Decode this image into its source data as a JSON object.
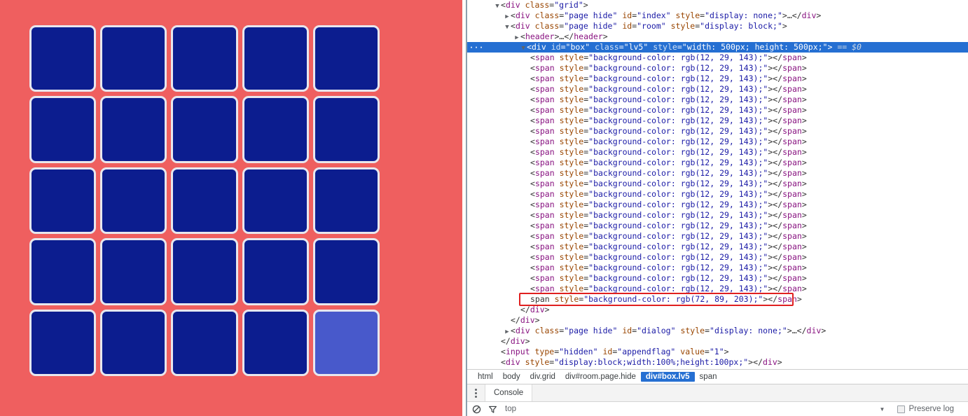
{
  "page": {
    "background_color": "#ef5f5f",
    "grid": {
      "name": "box",
      "rows": 5,
      "cols": 5,
      "default_cell_color": "#0c1d8f",
      "highlight_cell_color": "#4859cb",
      "cell_border_color": "#e7e7ee",
      "highlighted_index": 24
    }
  },
  "devtools": {
    "dom_nodes": [
      {
        "indent": 1,
        "twisty": "down",
        "html": "<span class=\"punc\">&lt;</span><span class=\"tag\">div</span> <span class=\"attr\">class</span><span class=\"punc\">=</span><span class=\"val\">\"grid\"</span><span class=\"punc\">&gt;</span>"
      },
      {
        "indent": 2,
        "twisty": "right",
        "html": "<span class=\"punc\">&lt;</span><span class=\"tag\">div</span> <span class=\"attr\">class</span><span class=\"punc\">=</span><span class=\"val\">\"page hide\"</span> <span class=\"attr\">id</span><span class=\"punc\">=</span><span class=\"val\">\"index\"</span> <span class=\"attr\">style</span><span class=\"punc\">=</span><span class=\"val\">\"display: none;\"</span><span class=\"punc\">&gt;</span><span class=\"txt\">…</span><span class=\"punc\">&lt;/</span><span class=\"tag\">div</span><span class=\"punc\">&gt;</span>"
      },
      {
        "indent": 2,
        "twisty": "down",
        "html": "<span class=\"punc\">&lt;</span><span class=\"tag\">div</span> <span class=\"attr\">class</span><span class=\"punc\">=</span><span class=\"val\">\"page hide\"</span> <span class=\"attr\">id</span><span class=\"punc\">=</span><span class=\"val\">\"room\"</span> <span class=\"attr\">style</span><span class=\"punc\">=</span><span class=\"val\">\"display: block;\"</span><span class=\"punc\">&gt;</span>"
      },
      {
        "indent": 3,
        "twisty": "right",
        "html": "<span class=\"punc\">&lt;</span><span class=\"tag\">header</span><span class=\"punc\">&gt;</span><span class=\"txt\">…</span><span class=\"punc\">&lt;/</span><span class=\"tag\">header</span><span class=\"punc\">&gt;</span>"
      },
      {
        "indent": 3,
        "twisty": "down",
        "selected": true,
        "html": "<span class=\"punc\">&lt;</span><span class=\"tag\">div</span> <span class=\"attr\">id</span><span class=\"punc\">=</span><span class=\"val\">\"box\"</span> <span class=\"attr\">class</span><span class=\"punc\">=</span><span class=\"val\">\"lv5\"</span> <span class=\"attr\">style</span><span class=\"punc\">=</span><span class=\"val\">\"width: 500px; height: 500px;\"</span><span class=\"punc\">&gt;</span> <span class=\"sel-eq\">== $0</span>"
      },
      {
        "indent": 4,
        "html": "SPAN"
      },
      {
        "indent": 4,
        "html": "SPAN"
      },
      {
        "indent": 4,
        "html": "SPAN"
      },
      {
        "indent": 4,
        "html": "SPAN"
      },
      {
        "indent": 4,
        "html": "SPAN"
      },
      {
        "indent": 4,
        "html": "SPAN"
      },
      {
        "indent": 4,
        "html": "SPAN"
      },
      {
        "indent": 4,
        "html": "SPAN"
      },
      {
        "indent": 4,
        "html": "SPAN"
      },
      {
        "indent": 4,
        "html": "SPAN"
      },
      {
        "indent": 4,
        "html": "SPAN"
      },
      {
        "indent": 4,
        "html": "SPAN"
      },
      {
        "indent": 4,
        "html": "SPAN"
      },
      {
        "indent": 4,
        "html": "SPAN"
      },
      {
        "indent": 4,
        "html": "SPAN"
      },
      {
        "indent": 4,
        "html": "SPAN"
      },
      {
        "indent": 4,
        "html": "SPAN"
      },
      {
        "indent": 4,
        "html": "SPAN"
      },
      {
        "indent": 4,
        "html": "SPAN"
      },
      {
        "indent": 4,
        "html": "SPAN"
      },
      {
        "indent": 4,
        "html": "SPAN"
      },
      {
        "indent": 4,
        "html": "SPAN"
      },
      {
        "indent": 4,
        "html": "SPAN"
      },
      {
        "indent": 4,
        "html": "SPAN_HL"
      },
      {
        "indent": 3,
        "html": "<span class=\"punc\">&lt;/</span><span class=\"tag\">div</span><span class=\"punc\">&gt;</span>"
      },
      {
        "indent": 2,
        "html": "<span class=\"punc\">&lt;/</span><span class=\"tag\">div</span><span class=\"punc\">&gt;</span>"
      },
      {
        "indent": 2,
        "twisty": "right",
        "html": "<span class=\"punc\">&lt;</span><span class=\"tag\">div</span> <span class=\"attr\">class</span><span class=\"punc\">=</span><span class=\"val\">\"page hide\"</span> <span class=\"attr\">id</span><span class=\"punc\">=</span><span class=\"val\">\"dialog\"</span> <span class=\"attr\">style</span><span class=\"punc\">=</span><span class=\"val\">\"display: none;\"</span><span class=\"punc\">&gt;</span><span class=\"txt\">…</span><span class=\"punc\">&lt;/</span><span class=\"tag\">div</span><span class=\"punc\">&gt;</span>"
      },
      {
        "indent": 1,
        "html": "<span class=\"punc\">&lt;/</span><span class=\"tag\">div</span><span class=\"punc\">&gt;</span>"
      },
      {
        "indent": 1,
        "html": "<span class=\"punc\">&lt;</span><span class=\"tag\">input</span> <span class=\"attr\">type</span><span class=\"punc\">=</span><span class=\"val\">\"hidden\"</span> <span class=\"attr\">id</span><span class=\"punc\">=</span><span class=\"val\">\"appendflag\"</span> <span class=\"attr\">value</span><span class=\"punc\">=</span><span class=\"val\">\"1\"</span><span class=\"punc\">&gt;</span>"
      },
      {
        "indent": 1,
        "html": "<span class=\"punc\">&lt;</span><span class=\"tag\">div</span> <span class=\"attr\">style</span><span class=\"punc\">=</span><span class=\"val\">\"display:block;width:100%;height:100px;\"</span><span class=\"punc\">&gt;</span><span class=\"punc\">&lt;/</span><span class=\"tag\">div</span><span class=\"punc\">&gt;</span>"
      }
    ],
    "span_node_text": "<span style=\"background-color: rgb(12, 29, 143);\"></span>",
    "span_node_highlight_text": "span style=\"background-color: rgb(72, 89, 203);\"></span>",
    "selected_badge": "···",
    "selected_marker": "== $0",
    "annotation_color": "#e02020",
    "span_color_default": "rgb(12, 29, 143)",
    "span_color_highlight": "rgb(72, 89, 203)",
    "breadcrumb": [
      {
        "label": "html",
        "active": false
      },
      {
        "label": "body",
        "active": false
      },
      {
        "label": "div.grid",
        "active": false
      },
      {
        "label": "div#room.page.hide",
        "active": false
      },
      {
        "label": "div#box.lv5",
        "active": true
      },
      {
        "label": "span",
        "active": false
      }
    ],
    "drawer": {
      "tabs": [
        {
          "label": "Console",
          "active": true
        }
      ],
      "toolbar": {
        "context": "top",
        "preserve_log_label": "Preserve log",
        "preserve_log_checked": false
      }
    }
  }
}
